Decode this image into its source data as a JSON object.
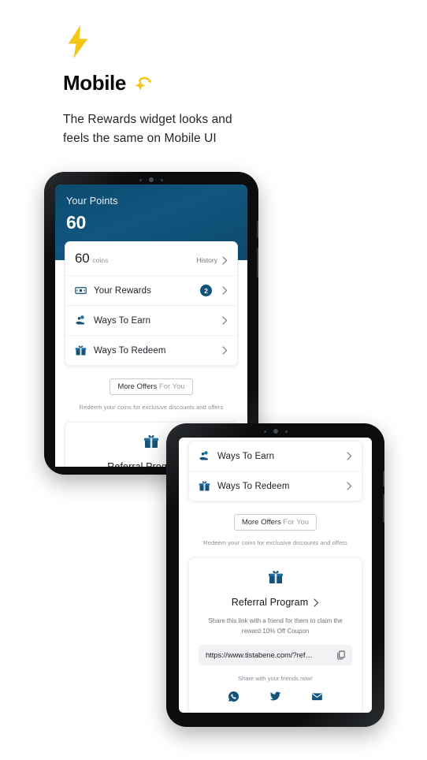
{
  "intro": {
    "bolt_icon": "lightning-bolt-icon",
    "title": "Mobile",
    "star_icon": "shooting-star-icon",
    "subtitle": "The Rewards widget looks and feels the same on Mobile UI"
  },
  "colors": {
    "header_gradient_start": "#0d4a6e",
    "header_gradient_mid": "#10567f",
    "brand_navy": "#10537a",
    "bolt_yellow": "#f5c518",
    "page_bg": "#ffffff",
    "text_dark": "#1d2026",
    "text_muted": "#8b9098"
  },
  "widget": {
    "header": {
      "points_label": "Your Points",
      "points_value": "60"
    },
    "coins_row": {
      "amount": "60",
      "unit": "coins",
      "history_label": "History",
      "history_chevron": "chevron-right-icon"
    },
    "rows": [
      {
        "label": "Your Rewards",
        "icon": "banknote-icon",
        "badge": "2",
        "chevron": "chevron-right-icon"
      },
      {
        "label": "Ways To Earn",
        "icon": "hand-coins-icon",
        "badge": null,
        "chevron": "chevron-right-icon"
      },
      {
        "label": "Ways To Redeem",
        "icon": "gift-icon",
        "badge": null,
        "chevron": "chevron-right-icon"
      }
    ],
    "offers": {
      "button_strong": "More Offers",
      "button_muted": "For You",
      "note": "Redeem your coins for exclusive discounts and offers"
    },
    "referral": {
      "gift_icon": "gift-icon",
      "title": "Referral Program",
      "title_chevron": "chevron-right-icon",
      "description": "Share this link with a friend for them to claim the reward 10% Off Coupon",
      "link": "https://www.tistabene.com/?ref…",
      "copy_icon": "copy-icon",
      "share_note": "Share with your friends now!",
      "socials": [
        {
          "name": "whatsapp-icon"
        },
        {
          "name": "twitter-icon"
        },
        {
          "name": "email-icon"
        }
      ]
    }
  },
  "devices": [
    {
      "name": "tablet-back",
      "camera_dots": 3
    },
    {
      "name": "tablet-front",
      "camera_dots": 3
    }
  ]
}
